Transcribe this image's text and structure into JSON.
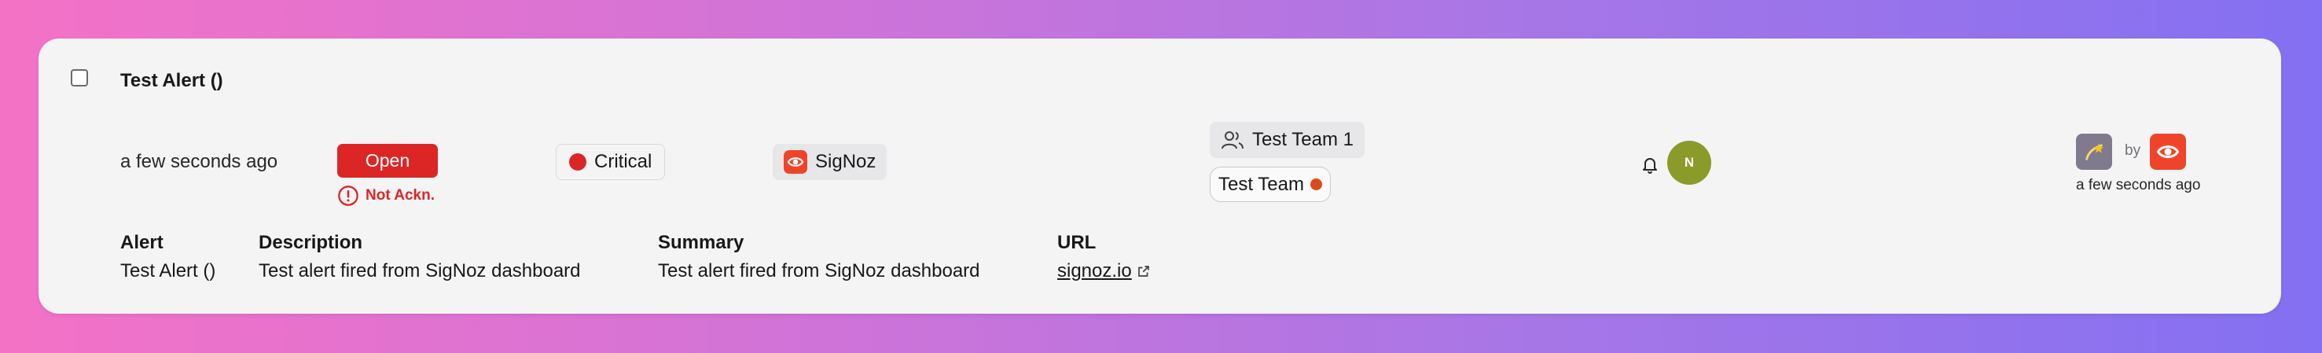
{
  "alert": {
    "title": "Test Alert ()",
    "time_ago": "a few seconds ago",
    "status": "Open",
    "ack_status": "Not Ackn.",
    "severity": {
      "label": "Critical",
      "color": "#dc2626"
    },
    "source": {
      "label": "SigNoz",
      "icon": "eye-icon",
      "color": "#f0442a"
    },
    "teams": [
      "Test Team 1",
      "Test Team"
    ],
    "assignee": {
      "initial": "N",
      "color": "#8a9b2a"
    },
    "activity": {
      "by_label": "by",
      "time": "a few seconds ago"
    }
  },
  "details": {
    "headers": [
      "Alert",
      "Description",
      "Summary",
      "URL"
    ],
    "values": {
      "alert": "Test Alert ()",
      "description": "Test alert fired from SigNoz dashboard",
      "summary": "Test alert fired from SigNoz dashboard",
      "url": "signoz.io"
    }
  }
}
